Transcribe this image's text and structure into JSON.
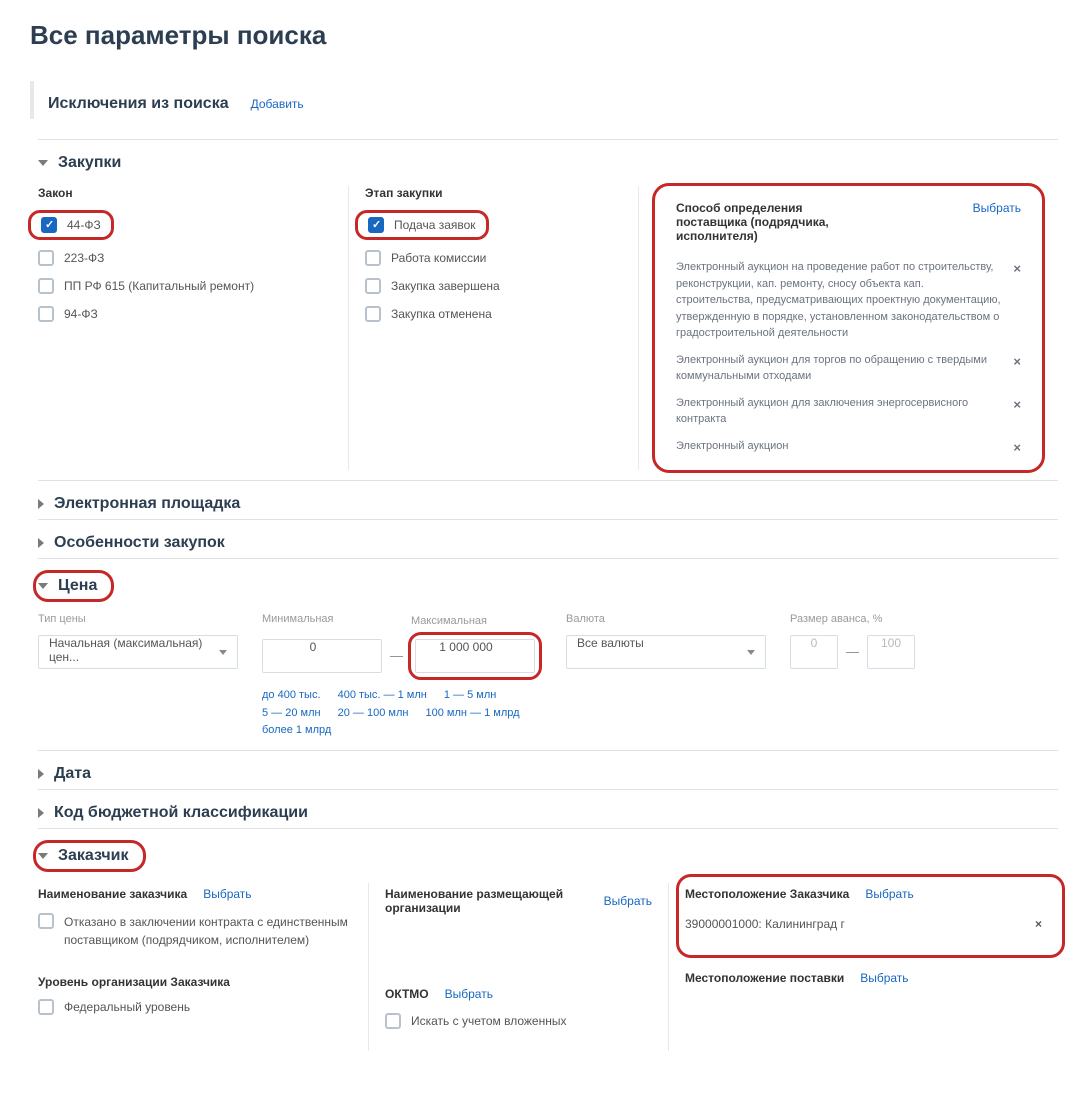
{
  "page_title": "Все параметры поиска",
  "exclusions": {
    "title": "Исключения из поиска",
    "add_link": "Добавить"
  },
  "purchases": {
    "title": "Закупки",
    "law_label": "Закон",
    "laws": [
      {
        "label": "44-ФЗ",
        "checked": true
      },
      {
        "label": "223-ФЗ",
        "checked": false
      },
      {
        "label": "ПП РФ 615 (Капитальный ремонт)",
        "checked": false
      },
      {
        "label": "94-ФЗ",
        "checked": false
      }
    ],
    "stage_label": "Этап закупки",
    "stages": [
      {
        "label": "Подача заявок",
        "checked": true
      },
      {
        "label": "Работа комиссии",
        "checked": false
      },
      {
        "label": "Закупка завершена",
        "checked": false
      },
      {
        "label": "Закупка отменена",
        "checked": false
      }
    ],
    "supplier": {
      "title": "Способ определения поставщика (подрядчика, исполнителя)",
      "select_link": "Выбрать",
      "items": [
        "Электронный аукцион на проведение работ по строительству, реконструкции, кап. ремонту, сносу объекта кап. строительства, предусматривающих проектную документацию, утвержденную в порядке, установленном законодательством о градостроительной деятельности",
        "Электронный аукцион для торгов по обращению с твердыми коммунальными отходами",
        "Электронный аукцион для заключения энергосервисного контракта",
        "Электронный аукцион"
      ]
    }
  },
  "platform": {
    "title": "Электронная площадка"
  },
  "features": {
    "title": "Особенности закупок"
  },
  "price": {
    "title": "Цена",
    "type_label": "Тип цены",
    "type_value": "Начальная (максимальная) цен...",
    "min_label": "Минимальная",
    "min_value": "0",
    "max_label": "Максимальная",
    "max_value": "1 000 000",
    "currency_label": "Валюта",
    "currency_value": "Все валюты",
    "advance_label": "Размер аванса, %",
    "advance_min": "0",
    "advance_max": "100",
    "presets": [
      "до 400 тыс.",
      "400 тыс. — 1 млн",
      "1 — 5 млн",
      "5 — 20 млн",
      "20 — 100 млн",
      "100 млн — 1 млрд",
      "более 1 млрд"
    ]
  },
  "date": {
    "title": "Дата"
  },
  "kbk": {
    "title": "Код бюджетной классификации"
  },
  "customer": {
    "title": "Заказчик",
    "name_label": "Наименование заказчика",
    "select_link": "Выбрать",
    "refused_label": "Отказано в заключении контракта с единственным поставщиком (подрядчиком, исполнителем)",
    "org_level_label": "Уровень организации Заказчика",
    "level_federal": "Федеральный уровень",
    "placing_org_label": "Наименование размещающей организации",
    "oktmo_label": "ОКТМО",
    "nested_label": "Искать с учетом вложенных",
    "location_label": "Местоположение Заказчика",
    "location_item": "39000001000: Калининград г",
    "delivery_label": "Местоположение поставки"
  }
}
